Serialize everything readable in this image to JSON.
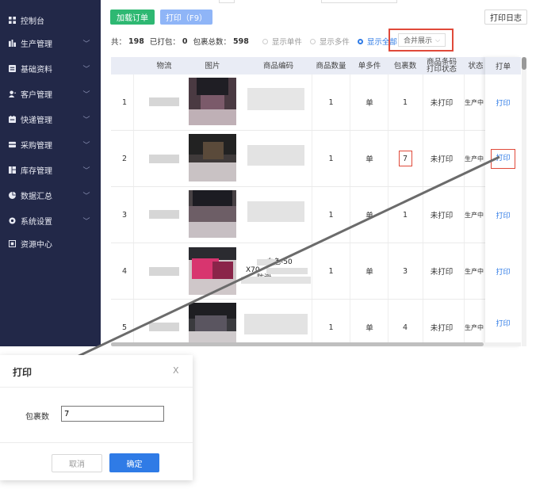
{
  "sidebar": {
    "items": [
      {
        "label": "控制台",
        "icon": "dashboard-icon",
        "expandable": false
      },
      {
        "label": "生产管理",
        "icon": "production-icon",
        "expandable": true
      },
      {
        "label": "基础资料",
        "icon": "basic-data-icon",
        "expandable": true
      },
      {
        "label": "客户管理",
        "icon": "customer-icon",
        "expandable": true
      },
      {
        "label": "快递管理",
        "icon": "express-icon",
        "expandable": true
      },
      {
        "label": "采购管理",
        "icon": "purchase-icon",
        "expandable": true
      },
      {
        "label": "库存管理",
        "icon": "inventory-icon",
        "expandable": true
      },
      {
        "label": "数据汇总",
        "icon": "pie-chart-icon",
        "expandable": true
      },
      {
        "label": "系统设置",
        "icon": "settings-icon",
        "expandable": true
      },
      {
        "label": "资源中心",
        "icon": "resource-icon",
        "expandable": false
      }
    ]
  },
  "toolbar": {
    "load_order": "加载订单",
    "print": "打印（F9）",
    "print_log": "打印日志"
  },
  "summary": {
    "total_label": "共：",
    "total": "198",
    "printed_label": "已打包：",
    "printed": "0",
    "packages_label": "包裹总数：",
    "packages": "598",
    "options": [
      {
        "label": "显示单件",
        "selected": false
      },
      {
        "label": "显示多件",
        "selected": false
      },
      {
        "label": "显示全部",
        "selected": true
      }
    ],
    "merge_display": "合并展示",
    "merge_chevron": "⌵"
  },
  "table": {
    "headers": {
      "logistics": "物流",
      "image": "图片",
      "sku": "商品编码",
      "qty": "商品数量",
      "single_multi": "单多件",
      "pkg_count": "包裹数",
      "barcode_status": "商品条码\n打印状态",
      "status": "状态",
      "print": "打单"
    },
    "rows": [
      {
        "no": "1",
        "qty": "1",
        "type": "单",
        "pkg": "1",
        "barcode": "未打印",
        "status": "生产中",
        "action": "打印"
      },
      {
        "no": "2",
        "qty": "1",
        "type": "单",
        "pkg": "7",
        "barcode": "未打印",
        "status": "生产中",
        "action": "打印"
      },
      {
        "no": "3",
        "qty": "1",
        "type": "单",
        "pkg": "1",
        "barcode": "未打印",
        "status": "生产中",
        "action": "打印"
      },
      {
        "no": "4",
        "qty": "1",
        "type": "单",
        "pkg": "3",
        "barcode": "未打印",
        "status": "生产中",
        "action": "打印"
      },
      {
        "no": "5",
        "qty": "1",
        "type": "单",
        "pkg": "4",
        "barcode": "未打印",
        "status": "生产中",
        "action": "打印"
      }
    ],
    "row4_sku_text": [
      "白色-50",
      "X70",
      "防滑"
    ]
  },
  "dialog": {
    "title": "打印",
    "close": "X",
    "field_label": "包裹数",
    "field_value": "7",
    "cancel": "取消",
    "confirm": "确定"
  },
  "colors": {
    "sidebar_bg": "#222848",
    "primary": "#2f7be6",
    "success": "#2eb872",
    "highlight": "#e04a3a"
  }
}
